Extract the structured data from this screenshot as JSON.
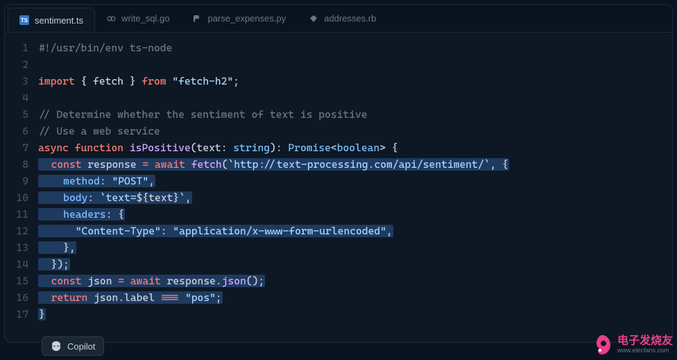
{
  "tabs": [
    {
      "label": "sentiment.ts",
      "icon": "TS",
      "active": true
    },
    {
      "label": "write_sql.go",
      "icon": "go",
      "active": false
    },
    {
      "label": "parse_expenses.py",
      "icon": "py",
      "active": false
    },
    {
      "label": "addresses.rb",
      "icon": "rb",
      "active": false
    }
  ],
  "copilot_label": "Copilot",
  "watermark": {
    "cn": "电子发烧友",
    "url": "www.elecfans.com"
  },
  "code_lines": [
    {
      "n": 1,
      "hl": false,
      "tokens": [
        {
          "t": "#!/usr/bin/env ts-node",
          "c": "c-comment"
        }
      ]
    },
    {
      "n": 2,
      "hl": false,
      "tokens": []
    },
    {
      "n": 3,
      "hl": false,
      "tokens": [
        {
          "t": "import",
          "c": "c-keyword"
        },
        {
          "t": " { ",
          "c": "c-punct"
        },
        {
          "t": "fetch",
          "c": "c-var"
        },
        {
          "t": " } ",
          "c": "c-punct"
        },
        {
          "t": "from",
          "c": "c-keyword"
        },
        {
          "t": " ",
          "c": "c-default"
        },
        {
          "t": "\"fetch-h2\"",
          "c": "c-string"
        },
        {
          "t": ";",
          "c": "c-punct"
        }
      ]
    },
    {
      "n": 4,
      "hl": false,
      "tokens": []
    },
    {
      "n": 5,
      "hl": false,
      "tokens": [
        {
          "t": "// Determine whether the sentiment of text is positive",
          "c": "c-comment"
        }
      ]
    },
    {
      "n": 6,
      "hl": false,
      "tokens": [
        {
          "t": "// Use a web service",
          "c": "c-comment"
        }
      ]
    },
    {
      "n": 7,
      "hl": false,
      "tokens": [
        {
          "t": "async",
          "c": "c-keyword"
        },
        {
          "t": " ",
          "c": "c-default"
        },
        {
          "t": "function",
          "c": "c-keyword"
        },
        {
          "t": " ",
          "c": "c-default"
        },
        {
          "t": "isPositive",
          "c": "c-func"
        },
        {
          "t": "(",
          "c": "c-punct"
        },
        {
          "t": "text",
          "c": "c-var"
        },
        {
          "t": ": ",
          "c": "c-punct"
        },
        {
          "t": "string",
          "c": "c-type"
        },
        {
          "t": ")",
          "c": "c-punct"
        },
        {
          "t": ": ",
          "c": "c-punct"
        },
        {
          "t": "Promise",
          "c": "c-type"
        },
        {
          "t": "<",
          "c": "c-punct"
        },
        {
          "t": "boolean",
          "c": "c-type"
        },
        {
          "t": "> {",
          "c": "c-punct"
        }
      ]
    },
    {
      "n": 8,
      "hl": true,
      "tokens": [
        {
          "t": "  ",
          "c": "c-default"
        },
        {
          "t": "const",
          "c": "c-keyword"
        },
        {
          "t": " response ",
          "c": "c-var"
        },
        {
          "t": "=",
          "c": "c-op"
        },
        {
          "t": " ",
          "c": "c-default"
        },
        {
          "t": "await",
          "c": "c-keyword"
        },
        {
          "t": " ",
          "c": "c-default"
        },
        {
          "t": "fetch",
          "c": "c-func"
        },
        {
          "t": "(",
          "c": "c-punct"
        },
        {
          "t": "`http://text-processing.com/api/sentiment/`",
          "c": "c-string"
        },
        {
          "t": ", {",
          "c": "c-punct"
        }
      ]
    },
    {
      "n": 9,
      "hl": true,
      "tokens": [
        {
          "t": "    ",
          "c": "c-default"
        },
        {
          "t": "method",
          "c": "c-prop"
        },
        {
          "t": ": ",
          "c": "c-punct"
        },
        {
          "t": "\"POST\"",
          "c": "c-string"
        },
        {
          "t": ",",
          "c": "c-punct"
        }
      ]
    },
    {
      "n": 10,
      "hl": true,
      "tokens": [
        {
          "t": "    ",
          "c": "c-default"
        },
        {
          "t": "body",
          "c": "c-prop"
        },
        {
          "t": ": ",
          "c": "c-punct"
        },
        {
          "t": "`text=",
          "c": "c-string"
        },
        {
          "t": "${",
          "c": "c-punct"
        },
        {
          "t": "text",
          "c": "c-var"
        },
        {
          "t": "}",
          "c": "c-punct"
        },
        {
          "t": "`",
          "c": "c-string"
        },
        {
          "t": ",",
          "c": "c-punct"
        }
      ]
    },
    {
      "n": 11,
      "hl": true,
      "tokens": [
        {
          "t": "    ",
          "c": "c-default"
        },
        {
          "t": "headers",
          "c": "c-prop"
        },
        {
          "t": ": {",
          "c": "c-punct"
        }
      ]
    },
    {
      "n": 12,
      "hl": true,
      "tokens": [
        {
          "t": "      ",
          "c": "c-default"
        },
        {
          "t": "\"Content-Type\"",
          "c": "c-string"
        },
        {
          "t": ": ",
          "c": "c-punct"
        },
        {
          "t": "\"application/x-www-form-urlencoded\"",
          "c": "c-string"
        },
        {
          "t": ",",
          "c": "c-punct"
        }
      ]
    },
    {
      "n": 13,
      "hl": true,
      "tokens": [
        {
          "t": "    },",
          "c": "c-punct"
        }
      ]
    },
    {
      "n": 14,
      "hl": true,
      "tokens": [
        {
          "t": "  });",
          "c": "c-punct"
        }
      ]
    },
    {
      "n": 15,
      "hl": true,
      "tokens": [
        {
          "t": "  ",
          "c": "c-default"
        },
        {
          "t": "const",
          "c": "c-keyword"
        },
        {
          "t": " json ",
          "c": "c-var"
        },
        {
          "t": "=",
          "c": "c-op"
        },
        {
          "t": " ",
          "c": "c-default"
        },
        {
          "t": "await",
          "c": "c-keyword"
        },
        {
          "t": " response.",
          "c": "c-var"
        },
        {
          "t": "json",
          "c": "c-func"
        },
        {
          "t": "();",
          "c": "c-punct"
        }
      ]
    },
    {
      "n": 16,
      "hl": true,
      "tokens": [
        {
          "t": "  ",
          "c": "c-default"
        },
        {
          "t": "return",
          "c": "c-keyword"
        },
        {
          "t": " json.label ",
          "c": "c-var"
        },
        {
          "t": "===",
          "c": "c-op"
        },
        {
          "t": " ",
          "c": "c-default"
        },
        {
          "t": "\"pos\"",
          "c": "c-string"
        },
        {
          "t": ";",
          "c": "c-punct"
        }
      ]
    },
    {
      "n": 17,
      "hl": true,
      "tokens": [
        {
          "t": "}",
          "c": "c-punct"
        }
      ]
    }
  ]
}
